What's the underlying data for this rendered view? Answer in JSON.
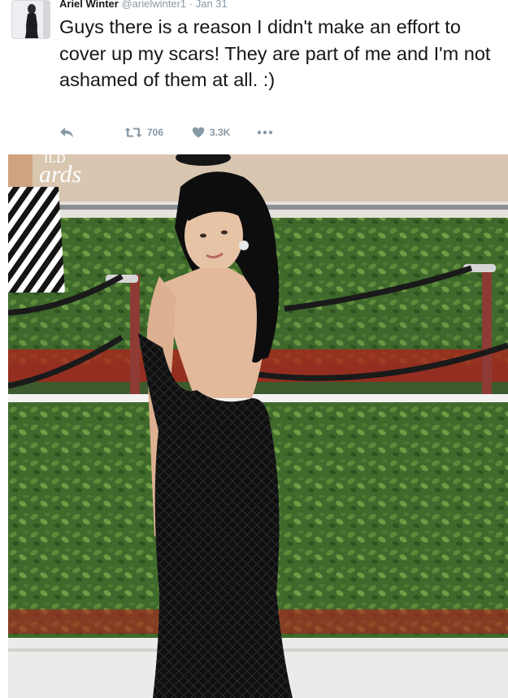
{
  "tweet": {
    "display_name": "Ariel Winter",
    "handle": "@arielwinter1",
    "separator": "·",
    "timestamp": "Jan 31",
    "text": "Guys there is a reason I didn't make an effort to cover up my scars! They are part of me and I'm not ashamed of them at all. :)"
  },
  "actions": {
    "reply_icon": "reply-icon",
    "retweet_icon": "retweet-icon",
    "retweet_count": "706",
    "like_icon": "heart-icon",
    "like_count": "3.3K",
    "more_icon": "more-dots-icon"
  },
  "media": {
    "backdrop_text": "ards",
    "backdrop_text_top": "ILD"
  },
  "colors": {
    "text": "#14171a",
    "muted": "#8899a6",
    "hedge": "#3f6a2c",
    "carpet": "#c7221f"
  }
}
